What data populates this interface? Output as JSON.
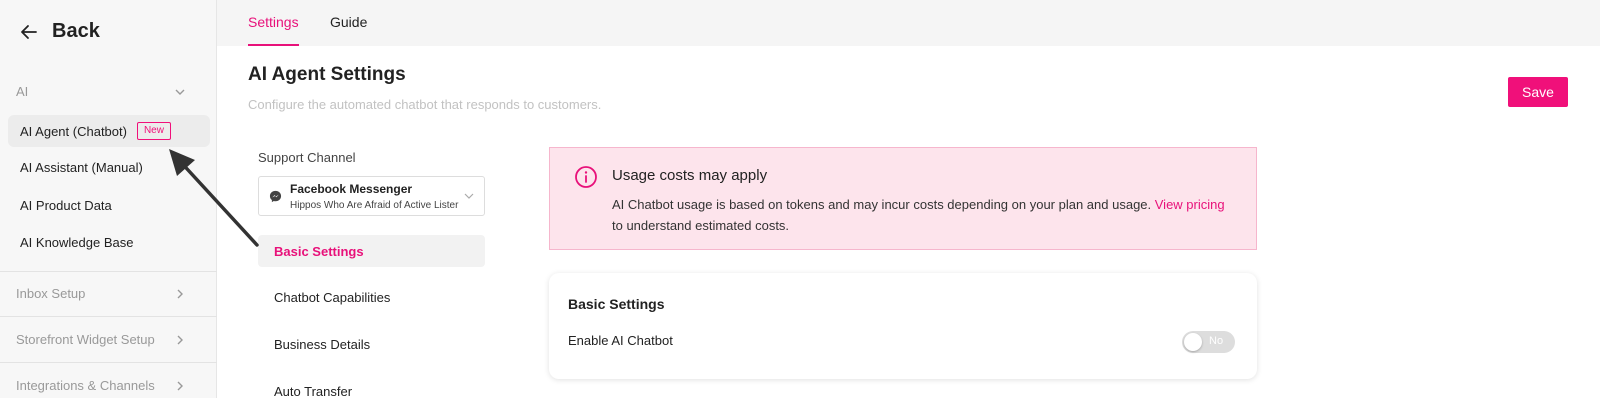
{
  "sidebar": {
    "back_label": "Back",
    "section_ai": "AI",
    "items": [
      {
        "label": "AI Agent (Chatbot)",
        "badge": "New"
      },
      {
        "label": "AI Assistant (Manual)"
      },
      {
        "label": "AI Product Data"
      },
      {
        "label": "AI Knowledge Base"
      }
    ],
    "sections": [
      {
        "label": "Inbox Setup"
      },
      {
        "label": "Storefront Widget Setup"
      },
      {
        "label": "Integrations & Channels"
      }
    ]
  },
  "tabs": [
    {
      "label": "Settings",
      "active": true
    },
    {
      "label": "Guide",
      "active": false
    }
  ],
  "main": {
    "title": "AI Agent Settings",
    "subtitle": "Configure the automated chatbot that responds to customers.",
    "save_label": "Save",
    "support_channel_label": "Support Channel",
    "channel": {
      "name": "Facebook Messenger",
      "page": "Hippos Who Are Afraid of Active Lister"
    },
    "sub_nav": [
      {
        "label": "Basic Settings",
        "active": true
      },
      {
        "label": "Chatbot Capabilities"
      },
      {
        "label": "Business Details"
      },
      {
        "label": "Auto Transfer"
      }
    ],
    "alert": {
      "title": "Usage costs may apply",
      "body_before": "AI Chatbot usage is based on tokens and may incur costs depending on your plan and usage. ",
      "link": "View pricing",
      "body_after": " to understand estimated costs."
    },
    "card": {
      "title": "Basic Settings",
      "row_label": "Enable AI Chatbot",
      "toggle_label": "No",
      "toggle_on": false
    }
  },
  "colors": {
    "accent": "#e8117a",
    "alert_bg": "#fde4ec",
    "alert_border": "#f6b6cd"
  }
}
